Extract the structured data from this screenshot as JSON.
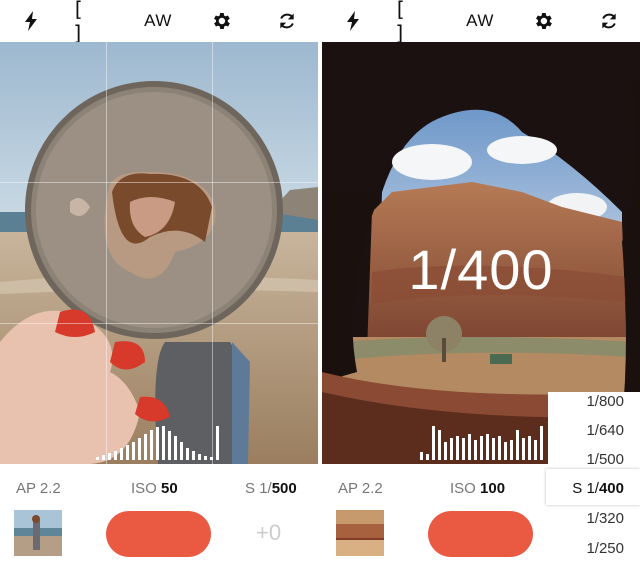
{
  "left": {
    "toolbar": {
      "flash_icon": "lightning-bolt",
      "frame": "[ ]",
      "wb": "AW",
      "settings_icon": "gear",
      "reset_icon": "refresh"
    },
    "readout": {
      "ap_label": "AP",
      "ap_value": "2.2",
      "iso_label": "ISO",
      "iso_value": "50",
      "s_label": "S",
      "s_prefix": "1/",
      "s_value": "500"
    },
    "ev": "+0"
  },
  "right": {
    "toolbar": {
      "flash_icon": "lightning-bolt",
      "frame": "[ ]",
      "wb": "AW",
      "settings_icon": "gear",
      "reset_icon": "refresh"
    },
    "overlay": "1/400",
    "readout": {
      "ap_label": "AP",
      "ap_value": "2.2",
      "iso_label": "ISO",
      "iso_value": "100"
    },
    "shutter_speeds": [
      "1/800",
      "1/640",
      "1/500",
      "1/400",
      "1/320",
      "1/250"
    ],
    "selected_speed_prefix": "S",
    "selected_speed_main": "1/",
    "selected_speed_value": "400"
  },
  "colors": {
    "shutter": "#ea5a43"
  }
}
